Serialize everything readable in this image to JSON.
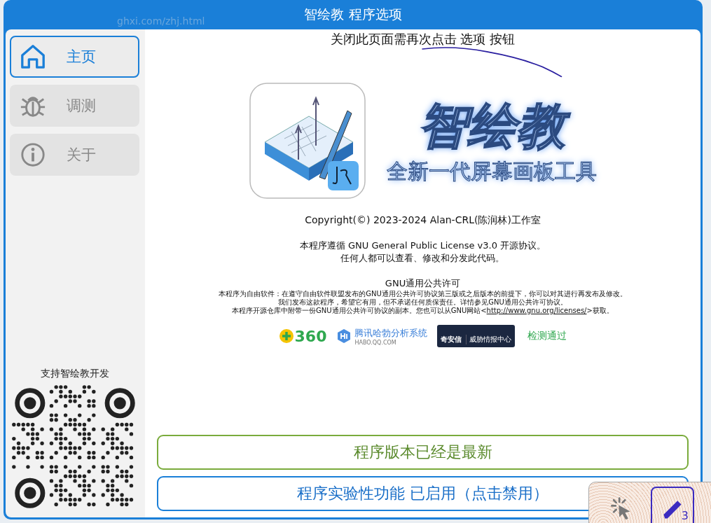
{
  "window": {
    "title": "智绘教 程序选项"
  },
  "browser": {
    "url": "ghxi.com/zhj.html"
  },
  "notice": "关闭此页面需再次点击 选项 按钮",
  "sidebar": {
    "items": [
      {
        "kind": "home",
        "label": "主页",
        "selected": true
      },
      {
        "kind": "bug",
        "label": "调测",
        "selected": false
      },
      {
        "kind": "info",
        "label": "关于",
        "selected": false
      }
    ],
    "support_caption": "支持智绘教开发"
  },
  "brand": {
    "name": "智绘教",
    "tagline": "全新一代屏幕画板工具"
  },
  "copyright": "Copyright(©) 2023-2024 Alan-CRL(陈润林)工作室",
  "license_lines": [
    "本程序遵循 GNU General Public License v3.0 开源协议。",
    "任何人都可以查看、修改和分发此代码。"
  ],
  "gpl": {
    "title": "GNU通用公共许可",
    "lines": [
      "本程序为自由软件：在遵守自由软件联盟发布的GNU通用公共许可协议第三版或之后版本的前提下，你可以对其进行再发布及修改。",
      "我们发布这款程序，希望它有用，但不承诺任何质保责任。详情参见GNU通用公共许可协议。"
    ],
    "last_line": {
      "before": "本程序开源仓库中附带一份GNU通用公共许可协议的副本。您也可以从GNU网站<",
      "link": "http://www.gnu.org/licenses/",
      "after": ">获取。"
    }
  },
  "scanners": [
    {
      "kind": "circle",
      "text": "360"
    },
    {
      "kind": "hexagon",
      "text": "腾讯哈勃分析系统",
      "sub": "HABO.QQ.COM"
    },
    {
      "kind": "panel",
      "text": "奇安信",
      "sub": "威胁情报中心"
    }
  ],
  "scan_result": "检测通过",
  "buttons": [
    {
      "kind": "status",
      "label": "程序版本已经是最新"
    },
    {
      "kind": "toggle",
      "label": "程序实验性功能 已启用（点击禁用）"
    }
  ],
  "toolbar": [
    {
      "kind": "cursor",
      "selected": false
    },
    {
      "kind": "pen",
      "selected": true,
      "badge": "3"
    }
  ]
}
